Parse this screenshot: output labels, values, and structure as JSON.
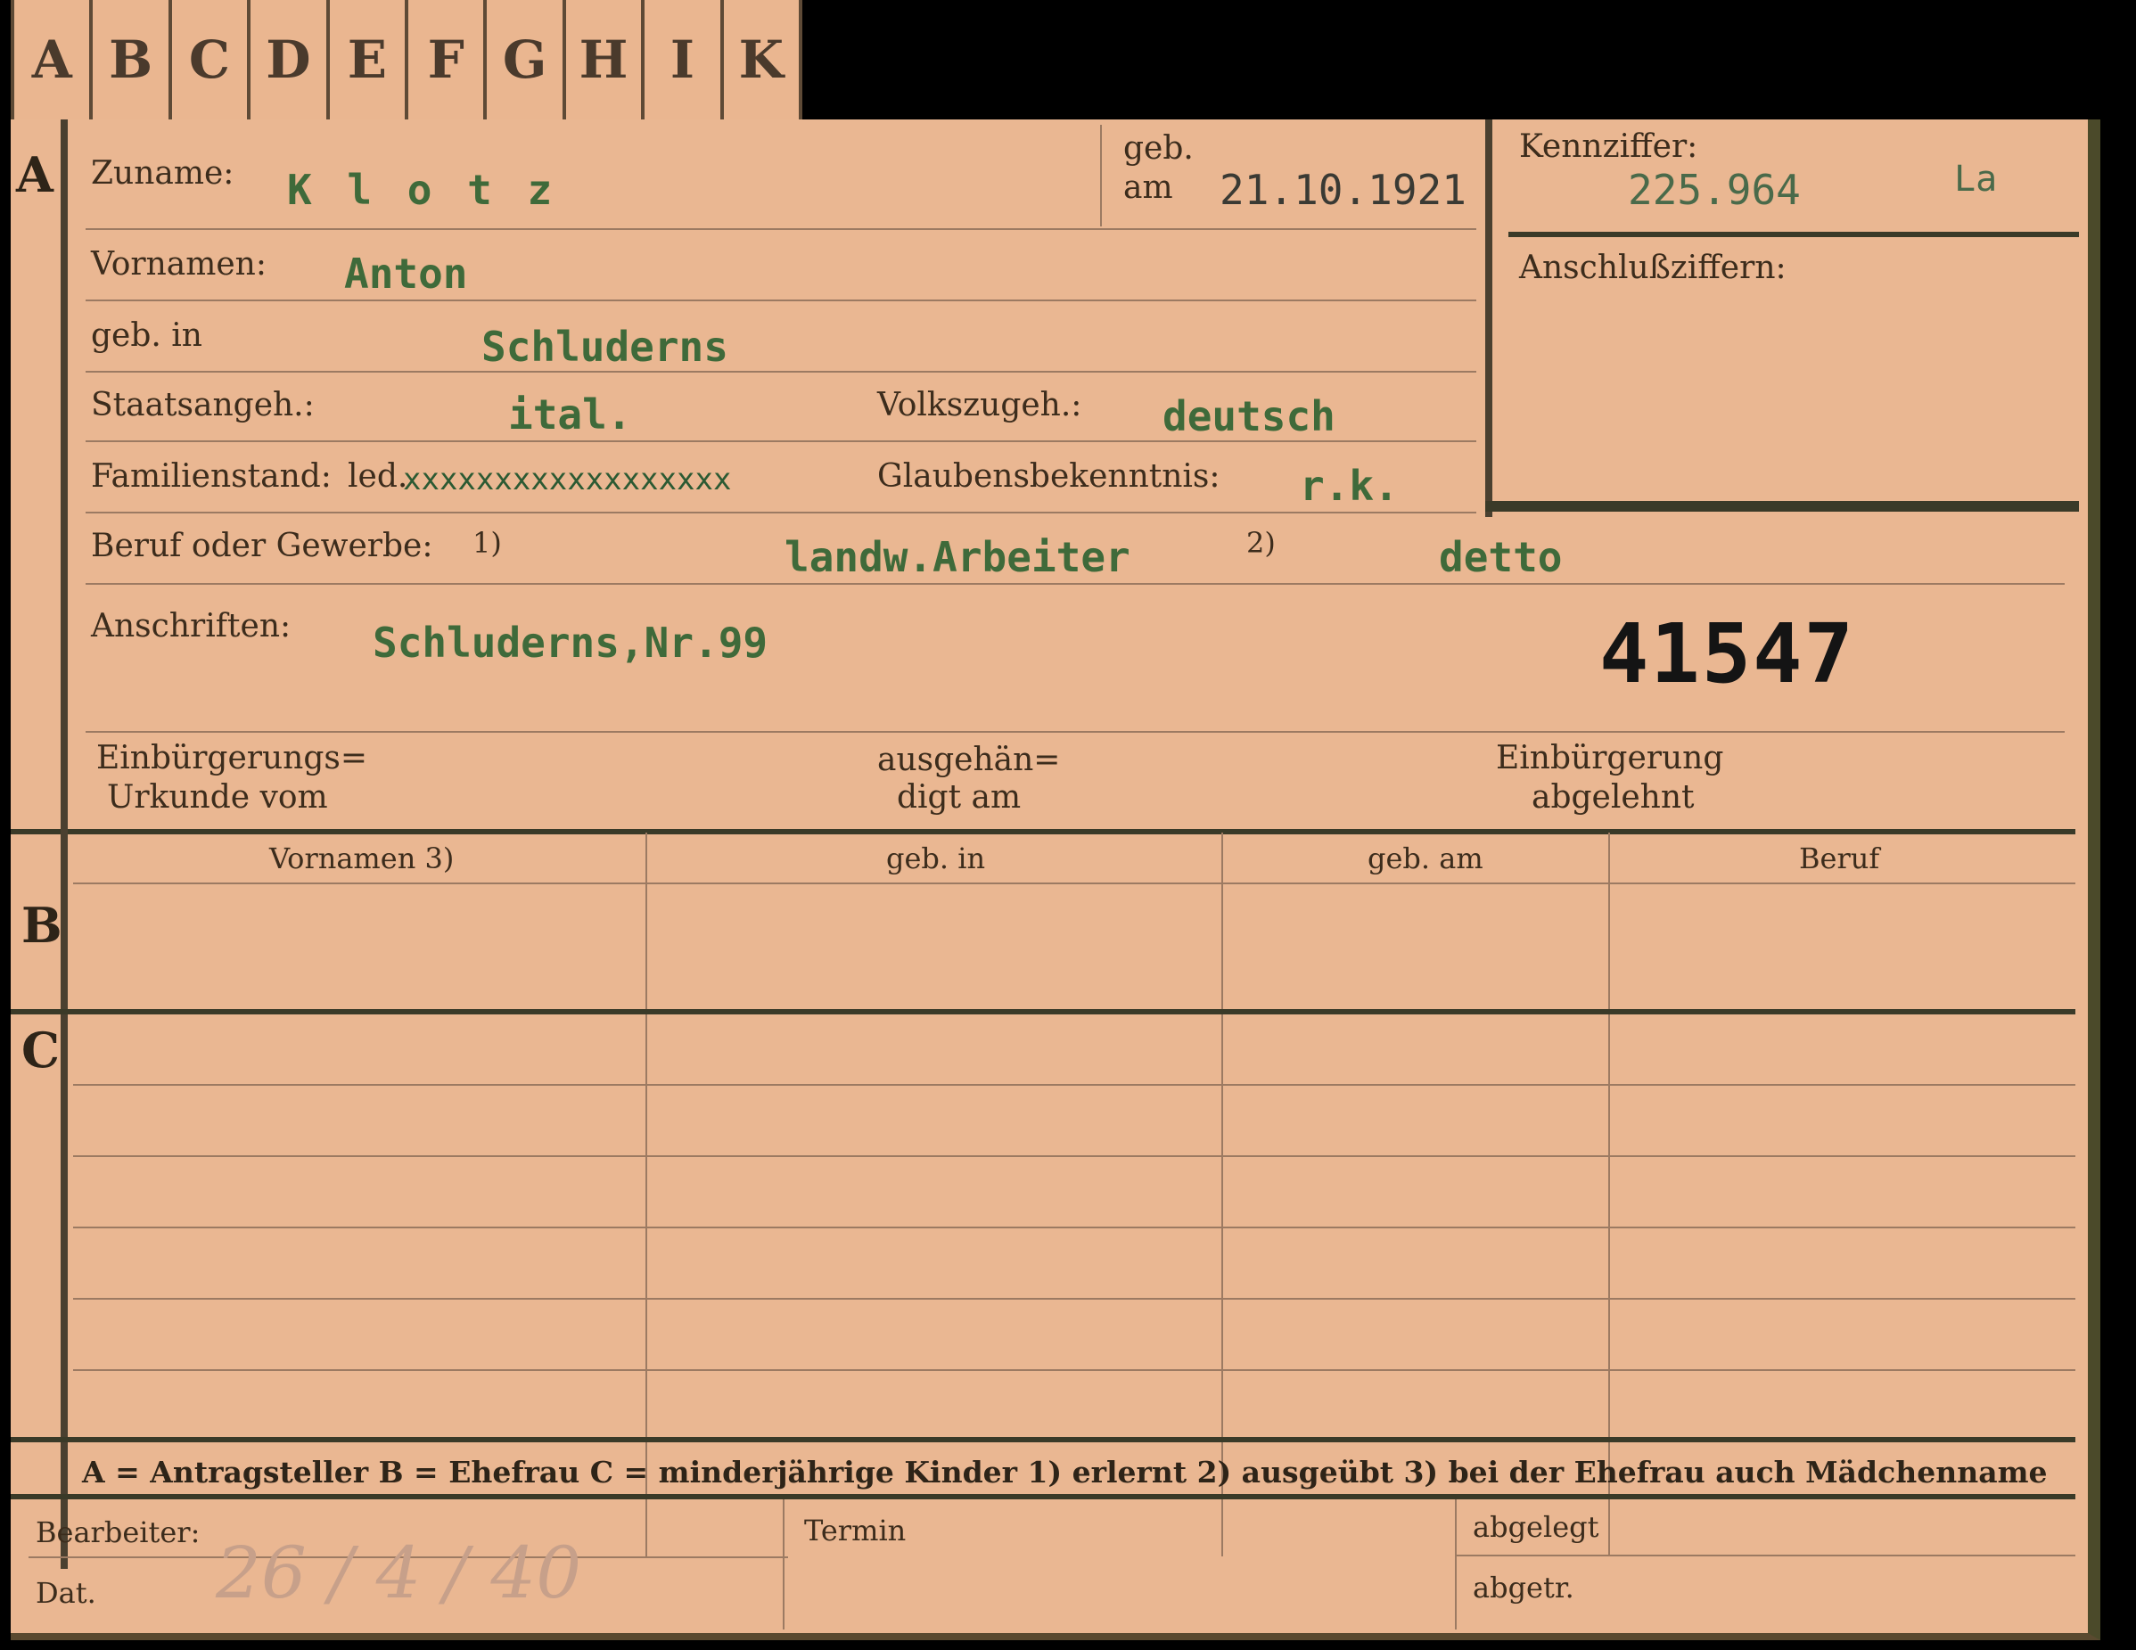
{
  "tabs": [
    "A",
    "B",
    "C",
    "D",
    "E",
    "F",
    "G",
    "H",
    "I",
    "K"
  ],
  "section_a": {
    "letter": "A",
    "zuname_label": "Zuname:",
    "zuname_value": "K l o t z",
    "geb_label_1": "geb.",
    "geb_label_2": "am",
    "geb_am_value": "21.10.1921",
    "kennziffer_label": "Kennziffer:",
    "kennziffer_value": "225.964",
    "kennziffer_suffix": "La",
    "anschluss_label": "Anschlußziffern:",
    "vornamen_label": "Vornamen:",
    "vornamen_value": "Anton",
    "geb_in_label": "geb. in",
    "geb_in_value": "Schluderns",
    "staatsangeh_label": "Staatsangeh.:",
    "staatsangeh_value": "ital.",
    "volkszugeh_label": "Volkszugeh.:",
    "volkszugeh_value": "deutsch",
    "familienstand_label": "Familienstand:",
    "familienstand_prefix": "led.",
    "familienstand_struck": "xxxxxxxxxxxxxxxxxx",
    "glaubens_label": "Glaubensbekenntnis:",
    "glaubens_value": "r.k.",
    "beruf_label": "Beruf oder Gewerbe:",
    "beruf_note1": "1)",
    "beruf_value1": "landw.Arbeiter",
    "beruf_note2": "2)",
    "beruf_value2": "detto",
    "anschriften_label": "Anschriften:",
    "anschriften_value": "Schluderns,Nr.99",
    "stamp_number": "41547",
    "einbuergerung_urkunde_1": "Einbürgerungs=",
    "einbuergerung_urkunde_2": "Urkunde vom",
    "ausgehaendigt_1": "ausgehän=",
    "ausgehaendigt_2": "digt am",
    "einbuergerung_abgelehnt_1": "Einbürgerung",
    "einbuergerung_abgelehnt_2": "abgelehnt"
  },
  "section_b": {
    "letter": "B",
    "columns": [
      "Vornamen 3)",
      "geb. in",
      "geb. am",
      "Beruf"
    ]
  },
  "section_c": {
    "letter": "C"
  },
  "legend": "A = Antragsteller   B = Ehefrau   C = minderjährige Kinder   1) erlernt   2) ausgeübt   3) bei der Ehefrau auch Mädchenname",
  "footer": {
    "bearbeiter_label": "Bearbeiter:",
    "dat_label": "Dat.",
    "dat_value": "26 / 4 / 40",
    "termin_label": "Termin",
    "abgelegt_label": "abgelegt",
    "abgetr_label": "abgetr."
  }
}
